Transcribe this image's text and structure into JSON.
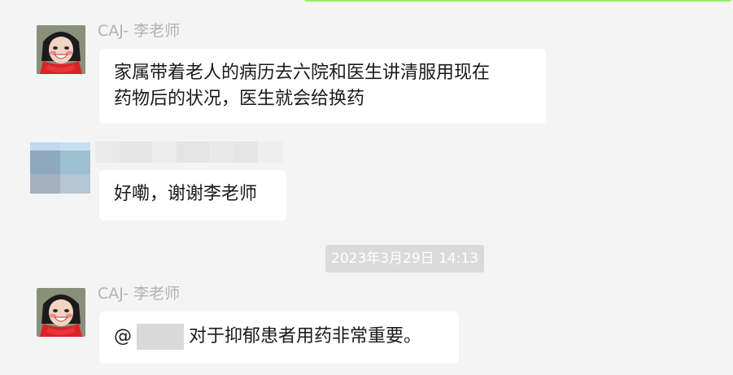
{
  "messages": [
    {
      "sender": "CAJ- 李老师",
      "text_lines": [
        "家属带着老人的病历去六院和医生讲清服用现在",
        "药物后的状况，医生就会给换药"
      ]
    },
    {
      "sender": "",
      "text": "好嘞，谢谢李老师"
    },
    {
      "sender": "CAJ- 李老师",
      "prefix": "@",
      "text": "对于抑郁患者用药非常重要。"
    }
  ],
  "timestamp": "2023年3月29日 14:13",
  "colors": {
    "background": "#f4f4f4",
    "own_bubble": "#95ec69",
    "bubble": "#ffffff",
    "timestamp_bg": "#dadada",
    "sender_text": "#b3b3b3"
  },
  "icons": {
    "avatar_teacher": "cartoon-girl-red-scarf-avatar",
    "avatar_user": "pixelated-avatar"
  }
}
